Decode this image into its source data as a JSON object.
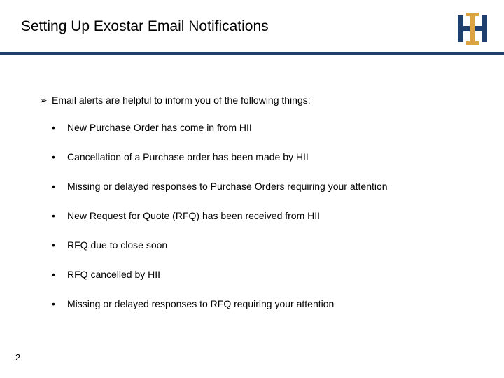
{
  "header": {
    "title": "Setting Up Exostar Email Notifications"
  },
  "lead": {
    "marker": "➢",
    "text": "Email alerts are helpful to inform you of the following things:"
  },
  "bullets": [
    "New Purchase Order has come in from HII",
    "Cancellation of a Purchase order has been made by HII",
    "Missing or delayed responses to Purchase Orders requiring your attention",
    "New Request for Quote (RFQ) has been received from HII",
    "RFQ due to close soon",
    "RFQ cancelled by HII",
    "Missing or delayed responses to RFQ requiring your attention"
  ],
  "page_number": "2",
  "brand": {
    "navy": "#1f3f6e",
    "gold": "#d9a441"
  }
}
